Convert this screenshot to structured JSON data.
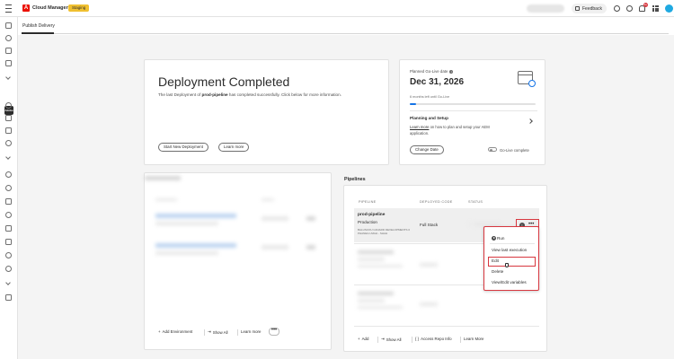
{
  "header": {
    "logo_letter": "A",
    "app_name": "Cloud Manager",
    "env_badge": "Staging",
    "feedback_label": "Feedback",
    "notification_count": "9+"
  },
  "rail": {
    "active_label": "Adobe"
  },
  "subnav": {
    "tab": "Publish Delivery"
  },
  "deployment": {
    "title": "Deployment Completed",
    "desc_prefix": "The last Deployment of ",
    "pipeline": "prod-pipeline",
    "desc_suffix": " has completed successfully. Click below for more information.",
    "start_button": "Start New Deployment",
    "learn_button": "Learn more"
  },
  "golive": {
    "label": "Planned Go-Live date",
    "date": "Dec 31, 2026",
    "time_left": "6 months left until Go-Live",
    "progress": 0.05,
    "plan_title": "Planning and Setup",
    "plan_link": "Learn more",
    "plan_desc": " on how to plan and setup your AEM application.",
    "change_button": "Change Date",
    "toggle_label": "Go-Live complete"
  },
  "environments": {
    "add_label": "Add Environment",
    "show_all_label": "Show All",
    "learn_label": "Learn more",
    "more_label": "•••"
  },
  "pipelines": {
    "heading": "Pipelines",
    "columns": [
      "PIPELINE",
      "DEPLOYED CODE",
      "STATUS"
    ],
    "row": {
      "name": "prod-pipeline",
      "type": "Production",
      "meta": "BALUSCOU CANARD DEVELOPMENTS 0 PHANEG LMGH  -  SHAH",
      "code": "Full Stack",
      "more": "•••",
      "info": "i"
    },
    "add_label": "Add",
    "show_all_label": "Show All",
    "repo_label": "Access Repo Info",
    "learn_label": "Learn More"
  },
  "menu": {
    "items": [
      "Run",
      "View last execution",
      "Edit",
      "Delete",
      "View/Edit variables"
    ]
  }
}
